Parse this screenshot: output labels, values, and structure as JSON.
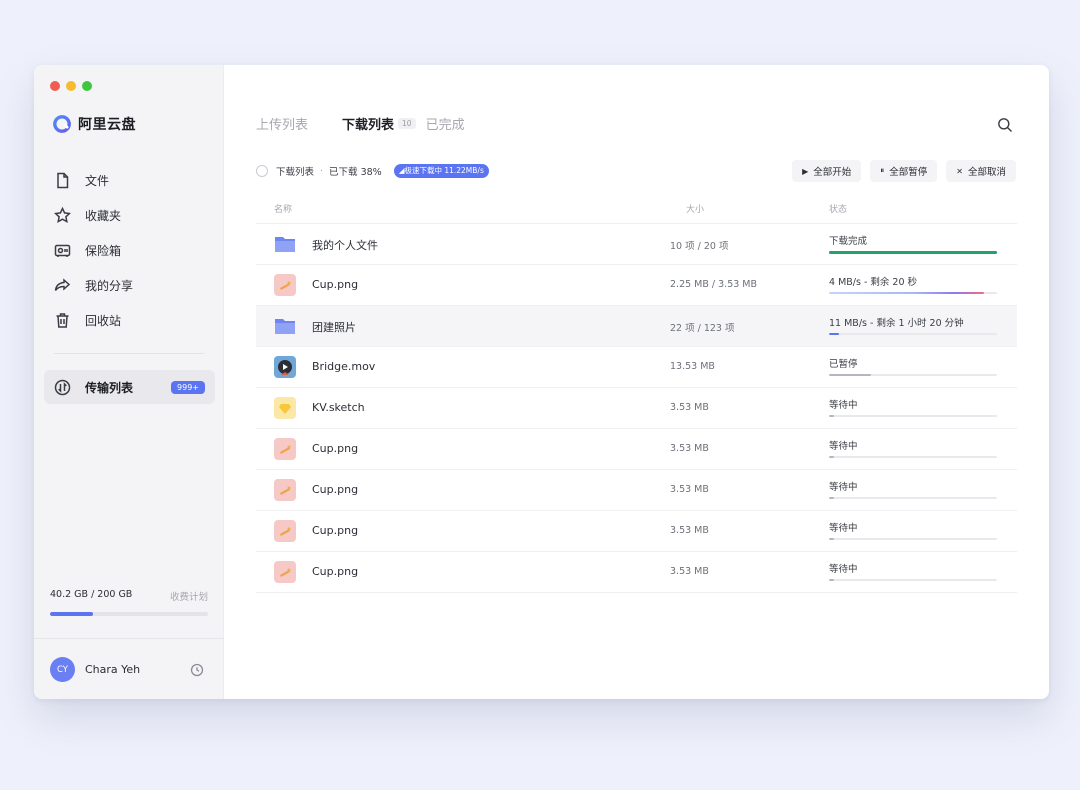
{
  "app": {
    "brand": "阿里云盘"
  },
  "sidebar": {
    "items": [
      {
        "label": "文件",
        "icon": "file-icon"
      },
      {
        "label": "收藏夹",
        "icon": "star-icon"
      },
      {
        "label": "保险箱",
        "icon": "safe-icon"
      },
      {
        "label": "我的分享",
        "icon": "share-icon"
      },
      {
        "label": "回收站",
        "icon": "trash-icon"
      }
    ],
    "active_item": {
      "label": "传输列表",
      "icon": "transfer-icon",
      "badge": "999+"
    },
    "storage": {
      "used": "40.2 GB / 200 GB",
      "plan_link": "收费计划",
      "fraction": 0.27
    },
    "user": {
      "initials": "CY",
      "name": "Chara Yeh"
    }
  },
  "tabs": {
    "upload": "上传列表",
    "download": "下载列表",
    "download_count": "10",
    "done": "已完成"
  },
  "summary": {
    "list_label": "下载列表",
    "dot": "·",
    "progress_text": "已下载 38%",
    "speed_badge": "◢极速下载中 11.22MB/s"
  },
  "actions": {
    "start_all": "全部开始",
    "start_icon": "▶",
    "pause_all": "全部暂停",
    "pause_icon": "⏸",
    "cancel_all": "全部取消",
    "cancel_icon": "✕"
  },
  "table": {
    "headers": {
      "name": "名称",
      "size": "大小",
      "status": "状态"
    },
    "rows": [
      {
        "type": "folder",
        "name": "我的个人文件",
        "size": "10 项 / 20 项",
        "status": "下载完成",
        "progress": 1.0,
        "state": "done"
      },
      {
        "type": "image",
        "name": "Cup.png",
        "size": "2.25 MB / 3.53 MB",
        "status": "4 MB/s - 剩余 20 秒",
        "progress": 0.92,
        "state": "gradient"
      },
      {
        "type": "folder",
        "name": "团建照片",
        "size": "22 项 / 123 项",
        "status": "11 MB/s - 剩余 1 小时 20 分钟",
        "progress": 0.06,
        "state": "active"
      },
      {
        "type": "video",
        "name": "Bridge.mov",
        "size": "13.53 MB",
        "status": "已暂停",
        "progress": 0.25,
        "state": "paused"
      },
      {
        "type": "sketch",
        "name": "KV.sketch",
        "size": "3.53 MB",
        "status": "等待中",
        "progress": 0.03,
        "state": "waiting"
      },
      {
        "type": "image",
        "name": "Cup.png",
        "size": "3.53 MB",
        "status": "等待中",
        "progress": 0.03,
        "state": "waiting"
      },
      {
        "type": "image",
        "name": "Cup.png",
        "size": "3.53 MB",
        "status": "等待中",
        "progress": 0.03,
        "state": "waiting"
      },
      {
        "type": "image",
        "name": "Cup.png",
        "size": "3.53 MB",
        "status": "等待中",
        "progress": 0.03,
        "state": "waiting"
      },
      {
        "type": "image",
        "name": "Cup.png",
        "size": "3.53 MB",
        "status": "等待中",
        "progress": 0.03,
        "state": "waiting"
      }
    ]
  },
  "colors": {
    "accent": "#5b74f2",
    "done": "#23a36b",
    "active": "#5b74f2",
    "paused": "#b5b7be",
    "waiting": "#b5b7be"
  }
}
